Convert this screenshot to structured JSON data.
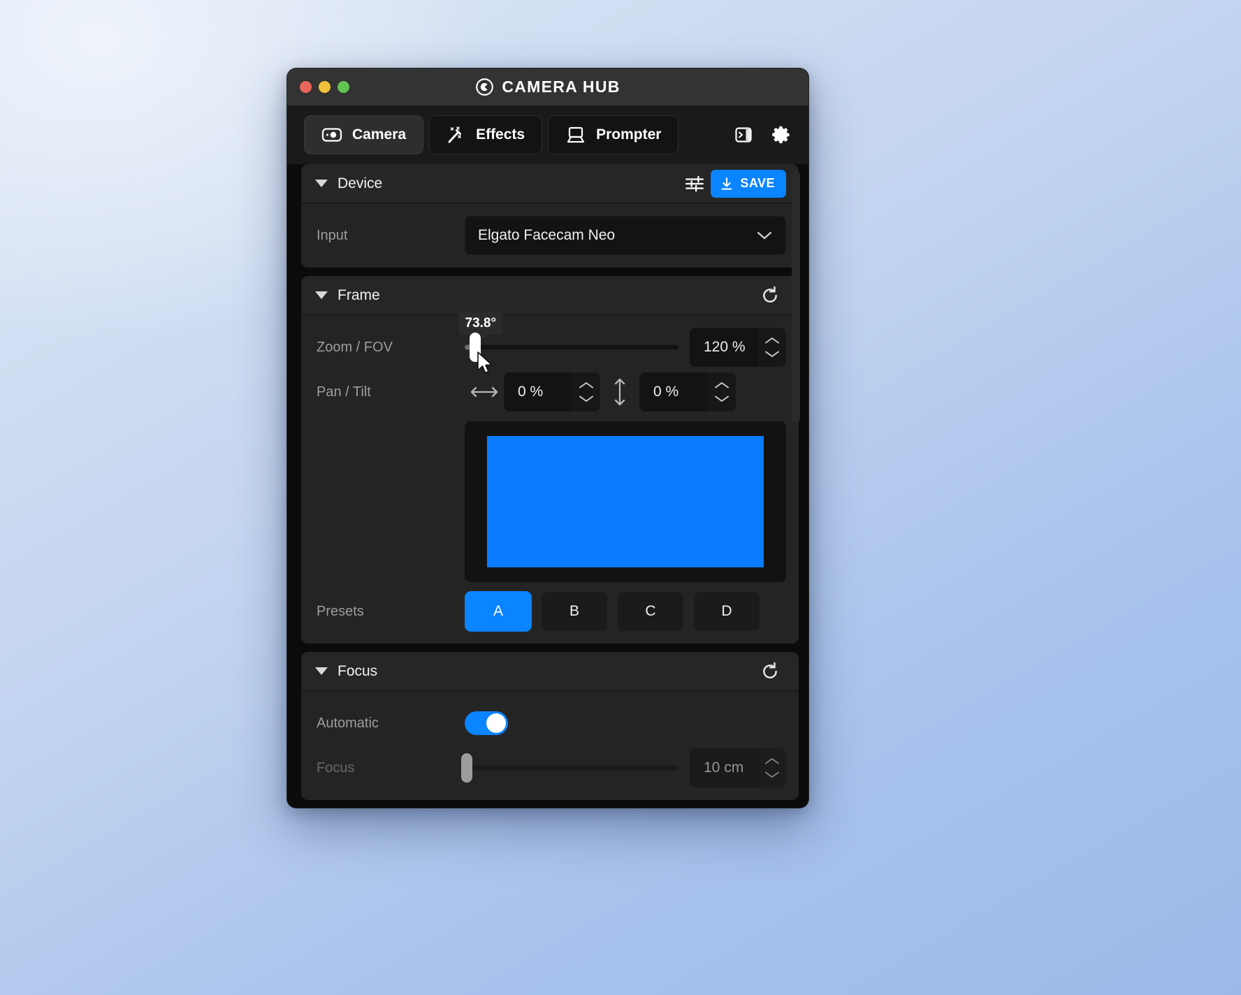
{
  "window": {
    "title": "CAMERA HUB",
    "traffic_lights": [
      "close-red",
      "minimize-yellow",
      "maximize-green"
    ],
    "logo_icon": "elgato-logo-icon"
  },
  "tabs": [
    {
      "label": "Camera",
      "icon": "camera-icon",
      "active": true
    },
    {
      "label": "Effects",
      "icon": "magic-wand-icon",
      "active": false
    },
    {
      "label": "Prompter",
      "icon": "prompter-icon",
      "active": false
    }
  ],
  "toolbar": {
    "sidebar_toggle_icon": "panel-right-icon",
    "settings_icon": "gear-icon"
  },
  "sections": {
    "device": {
      "title": "Device",
      "caret": "caret-down-icon",
      "tune_icon": "sliders-icon",
      "save_label": "SAVE",
      "save_icon": "download-icon",
      "input": {
        "label": "Input",
        "value": "Elgato Facecam Neo",
        "chevron": "chevron-down-icon"
      }
    },
    "frame": {
      "title": "Frame",
      "caret": "caret-down-icon",
      "reset_icon": "reset-icon",
      "zoom": {
        "label": "Zoom / FOV",
        "tooltip": "73.8°",
        "value": "120 %",
        "slider_percent": 5
      },
      "pan_tilt": {
        "label": "Pan / Tilt",
        "pan_icon": "arrows-horizontal-icon",
        "pan_value": "0 %",
        "tilt_icon": "arrows-vertical-icon",
        "tilt_value": "0 %"
      },
      "preview": {
        "name": "camera-preview"
      },
      "presets": {
        "label": "Presets",
        "items": [
          {
            "label": "A",
            "active": true
          },
          {
            "label": "B",
            "active": false
          },
          {
            "label": "C",
            "active": false
          },
          {
            "label": "D",
            "active": false
          }
        ]
      }
    },
    "focus": {
      "title": "Focus",
      "caret": "caret-down-icon",
      "reset_icon": "reset-icon",
      "automatic": {
        "label": "Automatic",
        "on": true
      },
      "distance": {
        "label": "Focus",
        "value": "10 cm",
        "slider_percent": 1
      }
    }
  },
  "colors": {
    "accent": "#0a84ff",
    "window_bg": "#1a1a1a",
    "titlebar": "#333333",
    "panel_head": "#262626",
    "panel_body": "#242424",
    "field": "#131313"
  }
}
